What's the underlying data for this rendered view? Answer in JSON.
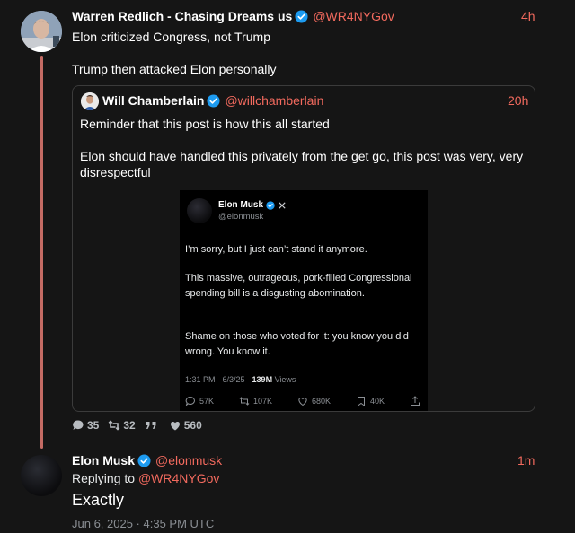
{
  "post": {
    "author_name": "Warren Redlich - Chasing Dreams us",
    "handle": "@WR4NYGov",
    "time": "4h",
    "text_line1": "Elon criticized Congress, not Trump",
    "text_line2": "Trump then attacked Elon personally"
  },
  "quote": {
    "author_name": "Will Chamberlain",
    "handle": "@willchamberlain",
    "time": "20h",
    "text_line1": "Reminder that this post is how this all started",
    "text_line2": "Elon should have handled this privately from the get go, this post was very, very",
    "text_line3": "disrespectful",
    "embed": {
      "name": "Elon Musk",
      "handle": "@elonmusk",
      "para1": "I’m sorry, but I just can’t stand it anymore.",
      "para2": "This massive, outrageous, pork-filled Congressional spending bill is a disgusting abomination.",
      "para3": "Shame on those who voted for it: you know you did wrong. You know it.",
      "meta_time": "1:31 PM · 6/3/25 · ",
      "meta_views": "139M",
      "meta_views_label": " Views",
      "replies": "57K",
      "reposts": "107K",
      "likes": "680K",
      "bookmarks": "40K"
    }
  },
  "stats": {
    "replies": "35",
    "reposts": "32",
    "quotes": "",
    "likes": "560"
  },
  "reply": {
    "author_name": "Elon Musk",
    "handle": "@elonmusk",
    "time": "1m",
    "replying_prefix": "Replying to ",
    "replying_handle": "@WR4NYGov",
    "text": "Exactly",
    "date": "Jun 6, 2025 · 4:35 PM UTC"
  },
  "colors": {
    "accent": "#f26a5e",
    "verified": "#1d9bf0",
    "thread_line": "#c46b64",
    "background": "#151515"
  }
}
